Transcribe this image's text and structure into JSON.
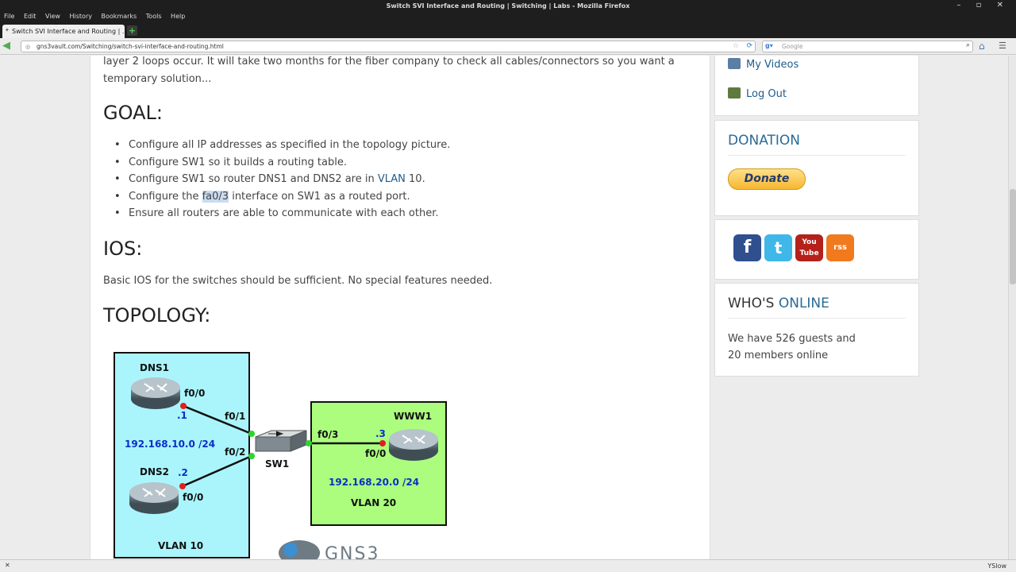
{
  "window": {
    "title": "Switch SVI Interface and Routing | Switching | Labs - Mozilla Firefox",
    "controls": "– ▫ ✕"
  },
  "menubar": [
    "File",
    "Edit",
    "View",
    "History",
    "Bookmarks",
    "Tools",
    "Help"
  ],
  "tab": {
    "label": "Switch SVI Interface and Routing | ..."
  },
  "url": "gns3vault.com/Switching/switch-svi-interface-and-routing.html",
  "search": {
    "placeholder": "Google"
  },
  "article": {
    "intro_line1": "layer 2 loops occur. It will take two months for the fiber company to check all cables/connectors so you want a",
    "intro_line2": "temporary solution...",
    "goal_heading": "GOAL:",
    "goals": [
      "Configure all IP addresses as specified in the topology picture.",
      "Configure SW1 so it builds a routing table.",
      "Configure SW1 so router DNS1 and DNS2 are in ",
      "Configure the ",
      "Ensure all routers are able to communicate with each other."
    ],
    "goal3_link": "VLAN",
    "goal3_tail": " 10.",
    "goal4_highlight": "fa0/3",
    "goal4_tail": " interface on SW1 as a routed port.",
    "ios_heading": "IOS:",
    "ios_text": "Basic IOS for the switches should be sufficient. No special features needed.",
    "topology_heading": "TOPOLOGY:"
  },
  "topology": {
    "dns1": "DNS1",
    "dns2": "DNS2",
    "www1": "WWW1",
    "sw1": "SW1",
    "dns1_if": "f0/0",
    "dns1_ip": ".1",
    "dns2_if": "f0/0",
    "dns2_ip": ".2",
    "sw_f01": "f0/1",
    "sw_f02": "f0/2",
    "sw_f03": "f0/3",
    "www_if": "f0/0",
    "www_ip": ".3",
    "net10": "192.168.10.0 /24",
    "net20": "192.168.20.0 /24",
    "vlan10": "VLAN 10",
    "vlan20": "VLAN 20",
    "gns3": "GNS3"
  },
  "sidebar": {
    "my_videos": "My Videos",
    "log_out": "Log Out",
    "donation_heading": "DONATION",
    "donate_button": "Donate",
    "whos_heading_a": "WHO'S ",
    "whos_heading_b": "ONLINE",
    "online_line1": "We have 526 guests and",
    "online_line2": "20 members online",
    "social": [
      "f",
      "t",
      "You Tube",
      "rss"
    ]
  },
  "statusbar": {
    "close": "✕",
    "yslow": "YSlow"
  },
  "colors": {
    "accent": "#2a6a96",
    "vlan10_bg": "#aaf5fb",
    "vlan20_bg": "#acfd7e"
  }
}
